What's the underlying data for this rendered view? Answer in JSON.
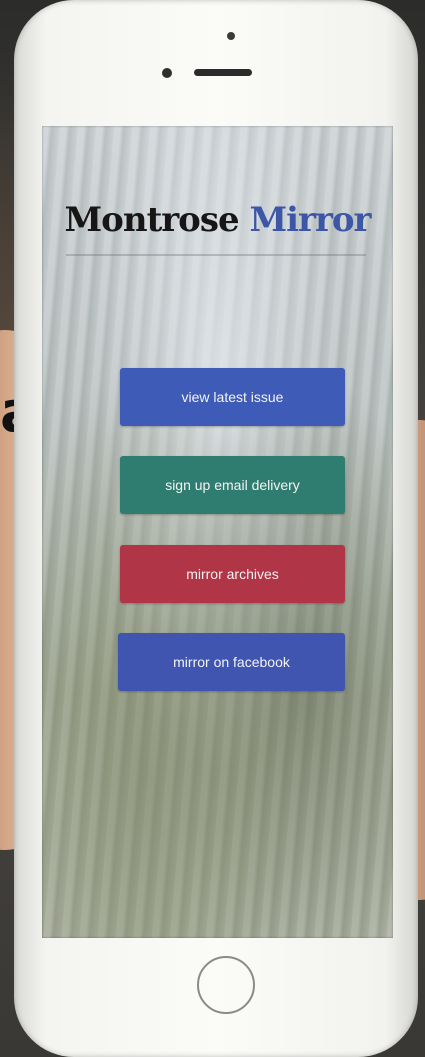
{
  "app": {
    "title_part1": "Montrose",
    "title_part2": "Mirror"
  },
  "buttons": {
    "latest": "view latest issue",
    "email": "sign up email delivery",
    "archives": "mirror archives",
    "facebook": "mirror on facebook"
  },
  "background_text": "a",
  "colors": {
    "logo_dark": "#161616",
    "logo_blue": "#3e56a6",
    "btn_latest": "#3f5bb8",
    "btn_email": "#2f7d70",
    "btn_archives": "#b03546",
    "btn_facebook": "#3f55b0"
  },
  "icons": {
    "home": "home-button-ring"
  }
}
